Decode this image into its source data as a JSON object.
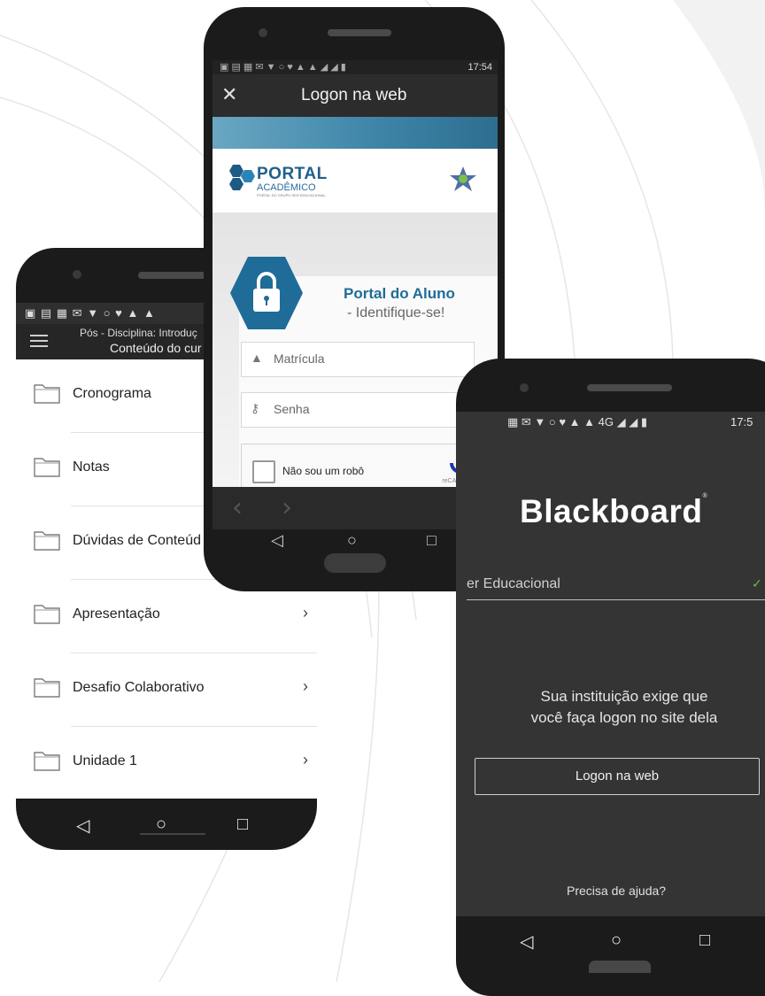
{
  "phone_list": {
    "statusbar_icons": "▣ ▤ ▦ ✉ ▼ ○ ♥ ▲ ▲",
    "toolbar": {
      "line1": "Pós - Disciplina: Introduç",
      "line2": "Conteúdo do cur"
    },
    "items": [
      {
        "label": "Cronograma",
        "chevron": ""
      },
      {
        "label": "Notas",
        "chevron": ""
      },
      {
        "label": "Dúvidas de Conteúd",
        "chevron": ""
      },
      {
        "label": "Apresentação",
        "chevron": "›"
      },
      {
        "label": "Desafio Colaborativo",
        "chevron": "›"
      },
      {
        "label": "Unidade 1",
        "chevron": "›"
      }
    ],
    "nav": {
      "back": "◁",
      "home": "○",
      "recents": "□"
    }
  },
  "phone_web": {
    "status_time": "17:54",
    "title": "Logon na web",
    "close": "✕",
    "logo": {
      "line1": "PORTAL",
      "line2": "ACADÊMICO",
      "line3": "PORTAL DO GRUPO SER EDUCACIONAL"
    },
    "portal_title": "Portal do Aluno",
    "portal_subtitle": "- Identifique-se!",
    "matricula_placeholder": "Matrícula",
    "senha_placeholder": "Senha",
    "captcha_label": "Não sou um robô",
    "captcha_brand": "reCAPTCHA",
    "browser": {
      "back": "‹",
      "forward": "›",
      "reload": "↻"
    }
  },
  "phone_blackboard": {
    "status_network": "4G",
    "status_time": "17:5",
    "brand": "Blackboard",
    "institution": "er Educacional",
    "check": "✓",
    "message_line1": "Sua instituição exige que",
    "message_line2": "você faça logon no site dela",
    "button": "Logon na web",
    "help": "Precisa de ajuda?",
    "nav": {
      "back": "◁",
      "home": "○",
      "recents": "□"
    }
  },
  "colors": {
    "accent_blue": "#1f6c99",
    "blackboard_bg": "#343434",
    "check_green": "#6dbd4b"
  }
}
